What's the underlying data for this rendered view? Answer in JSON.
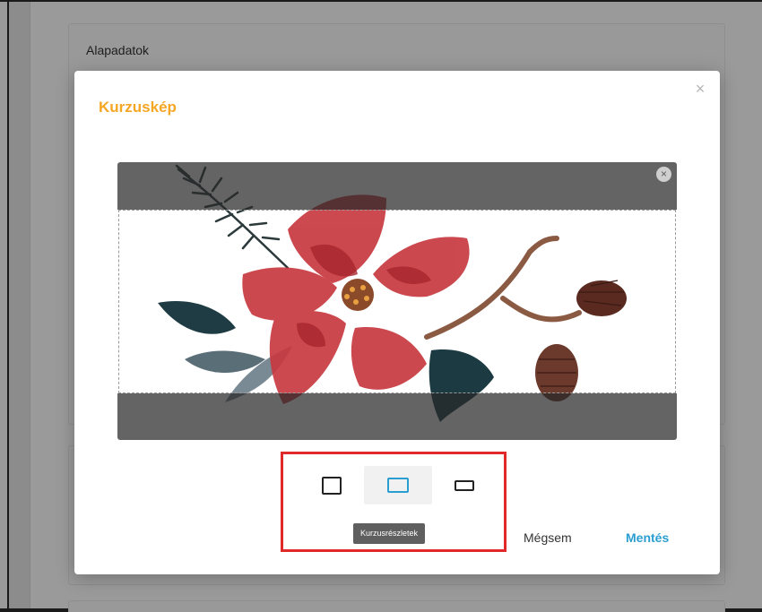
{
  "background": {
    "card_title": "Alapadatok"
  },
  "modal": {
    "title": "Kurzuskép",
    "close_glyph": "×",
    "cropper": {
      "remove_glyph": "×",
      "image_icon": "watercolor-flower-image"
    },
    "aspect_ratios": [
      {
        "shape": "square",
        "active": false
      },
      {
        "shape": "wide",
        "active": true
      },
      {
        "shape": "banner",
        "active": false
      }
    ],
    "tooltip": "Kurzusrészletek",
    "cancel_label": "Mégsem",
    "save_label": "Mentés"
  },
  "colors": {
    "title_accent": "#f5a623",
    "primary": "#2a9ed0",
    "highlight_border": "#e02a2a"
  }
}
